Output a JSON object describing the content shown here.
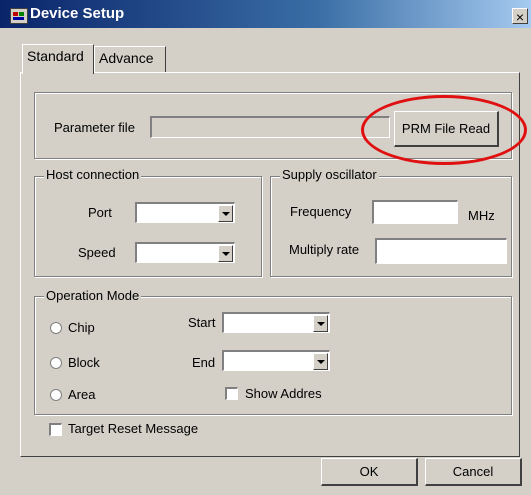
{
  "window": {
    "title": "Device Setup",
    "close_glyph": "×"
  },
  "tabs": [
    {
      "label": "Standard",
      "active": true
    },
    {
      "label": "Advance",
      "active": false
    }
  ],
  "parameter_file": {
    "label": "Parameter file",
    "value": "",
    "button_label": "PRM File Read"
  },
  "host_connection": {
    "title": "Host connection",
    "port_label": "Port",
    "port_value": "",
    "speed_label": "Speed",
    "speed_value": ""
  },
  "supply_oscillator": {
    "title": "Supply oscillator",
    "frequency_label": "Frequency",
    "frequency_value": "",
    "frequency_unit": "MHz",
    "multiply_label": "Multiply rate",
    "multiply_value": ""
  },
  "operation_mode": {
    "title": "Operation Mode",
    "options": [
      "Chip",
      "Block",
      "Area"
    ],
    "start_label": "Start",
    "start_value": "",
    "end_label": "End",
    "end_value": "",
    "show_address_label": "Show Addres"
  },
  "target_reset_label": "Target Reset Message",
  "footer": {
    "ok_label": "OK",
    "cancel_label": "Cancel"
  },
  "colors": {
    "title_start": "#0a246a",
    "face": "#d4d0c8",
    "highlight_ring": "#e01010"
  },
  "icons": [
    "app-icon",
    "close-icon",
    "dropdown-arrow-icon"
  ]
}
